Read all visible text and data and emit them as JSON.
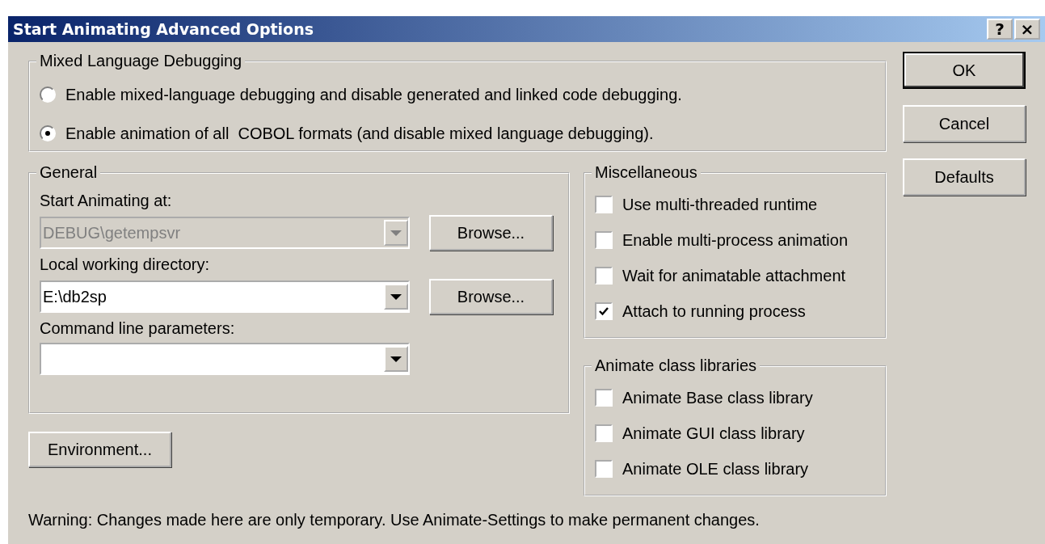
{
  "window": {
    "title": "Start Animating Advanced Options",
    "title_buttons": [
      "?",
      "×"
    ]
  },
  "mixed_language_debugging": {
    "title": "Mixed Language Debugging",
    "options": [
      {
        "label": "Enable mixed-language debugging and disable generated and linked code debugging.",
        "selected": false
      },
      {
        "label": "Enable animation of all  COBOL formats (and disable mixed language debugging).",
        "selected": true
      }
    ]
  },
  "general": {
    "title": "General",
    "fields": [
      {
        "label": "Start Animating at:",
        "value": "DEBUG\\getempsvr",
        "disabled": true,
        "button": "Browse..."
      },
      {
        "label": "Local working directory:",
        "value": "E:\\db2sp",
        "disabled": false,
        "button": "Browse..."
      },
      {
        "label": "Command line parameters:",
        "disabled": false
      }
    ]
  },
  "environment_button": "Environment...",
  "miscellaneous": {
    "title": "Miscellaneous",
    "options": [
      {
        "label": "Use multi-threaded runtime",
        "checked": false
      },
      {
        "label": "Enable multi-process animation",
        "checked": false
      },
      {
        "label": "Wait for animatable attachment",
        "checked": false
      },
      {
        "label": "Attach to running process",
        "checked": true
      }
    ]
  },
  "animate_class_libraries": {
    "title": "Animate class libraries",
    "options": [
      {
        "label": "Animate Base class library",
        "checked": false
      },
      {
        "label": "Animate GUI class library",
        "checked": false
      },
      {
        "label": "Animate OLE class library",
        "checked": false
      }
    ]
  },
  "buttons": [
    {
      "label": "OK",
      "default": true
    },
    {
      "label": "Cancel",
      "default": false
    },
    {
      "label": "Defaults",
      "default": false
    }
  ],
  "warning": "Warning: Changes made here are only temporary. Use Animate-Settings to make permanent changes."
}
